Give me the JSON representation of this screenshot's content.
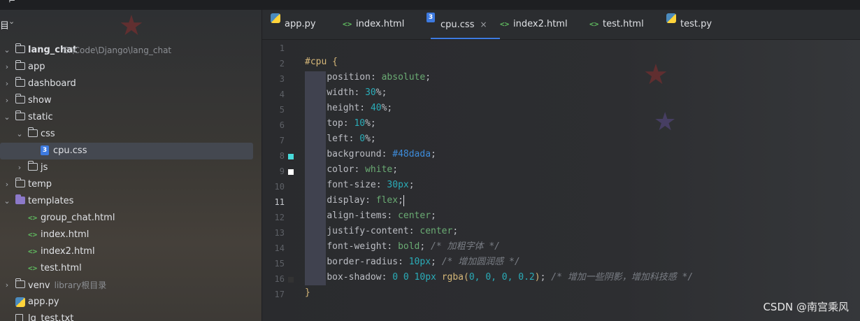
{
  "sidebar": {
    "header_label": "目",
    "project": {
      "name": "lang_chat",
      "path": "E:\\Code\\Django\\lang_chat"
    },
    "items": [
      {
        "name": "app",
        "type": "folder",
        "level": 1,
        "expanded": false
      },
      {
        "name": "dashboard",
        "type": "folder",
        "level": 1,
        "expanded": false
      },
      {
        "name": "show",
        "type": "folder",
        "level": 1,
        "expanded": false
      },
      {
        "name": "static",
        "type": "folder",
        "level": 1,
        "expanded": true
      },
      {
        "name": "css",
        "type": "folder",
        "level": 2,
        "expanded": true
      },
      {
        "name": "cpu.css",
        "type": "css",
        "level": 3,
        "selected": true
      },
      {
        "name": "js",
        "type": "folder",
        "level": 2,
        "expanded": false
      },
      {
        "name": "temp",
        "type": "folder",
        "level": 1,
        "expanded": false
      },
      {
        "name": "templates",
        "type": "folder-purple",
        "level": 1,
        "expanded": true
      },
      {
        "name": "group_chat.html",
        "type": "html",
        "level": 2
      },
      {
        "name": "index.html",
        "type": "html",
        "level": 2
      },
      {
        "name": "index2.html",
        "type": "html",
        "level": 2
      },
      {
        "name": "test.html",
        "type": "html",
        "level": 2
      },
      {
        "name": "venv",
        "type": "folder",
        "level": 1,
        "expanded": false,
        "note": "library根目录"
      },
      {
        "name": "app.py",
        "type": "py",
        "level": 1
      },
      {
        "name": "lg_test.txt",
        "type": "txt",
        "level": 1
      }
    ]
  },
  "tabs": [
    {
      "label": "app.py",
      "icon": "python-icon",
      "active": false
    },
    {
      "label": "index.html",
      "icon": "html-icon",
      "active": false
    },
    {
      "label": "cpu.css",
      "icon": "css-icon",
      "active": true,
      "close": "×"
    },
    {
      "label": "index2.html",
      "icon": "html-icon",
      "active": false
    },
    {
      "label": "test.html",
      "icon": "html-icon",
      "active": false
    },
    {
      "label": "test.py",
      "icon": "python-icon",
      "active": false
    }
  ],
  "editor": {
    "current_line": 11,
    "swatches": [
      {
        "line": 8,
        "color": "#48dada"
      },
      {
        "line": 9,
        "color": "#ffffff"
      },
      {
        "line": 16,
        "color": "#333333"
      }
    ],
    "code": {
      "l2_selector": "#cpu",
      "l2_brace": "{",
      "l3_prop": "position",
      "l3_value": "absolute",
      "l4_prop": "width",
      "l4_value": "30",
      "l5_prop": "height",
      "l5_value": "40",
      "l6_prop": "top",
      "l6_value": "10",
      "l7_prop": "left",
      "l7_value": "0",
      "l8_prop": "background",
      "l8_value": "#48dada",
      "l9_prop": "color",
      "l9_value": "white",
      "l10_prop": "font-size",
      "l10_value": "30px",
      "l11_prop": "display",
      "l11_value": "flex",
      "l12_prop": "align-items",
      "l12_value": "center",
      "l13_prop": "justify-content",
      "l13_value": "center",
      "l14_prop": "font-weight",
      "l14_value": "bold",
      "l14_comment": "/* 加粗字体 */",
      "l15_prop": "border-radius",
      "l15_value": "10px",
      "l15_comment": "/* 增加圆润感 */",
      "l16_prop": "box-shadow",
      "l16_pre": "0 0 10px",
      "l16_fn": "rgba(",
      "l16_args": "0, 0, 0, 0.2",
      "l16_close": ")",
      "l16_comment": "/* 增加一些阴影，增加科技感 */",
      "l17_brace": "}"
    }
  },
  "watermark": "CSDN @南宫乘风",
  "colors": {
    "accent": "#3d7ae0",
    "editor_bg": "#2b2d30"
  }
}
